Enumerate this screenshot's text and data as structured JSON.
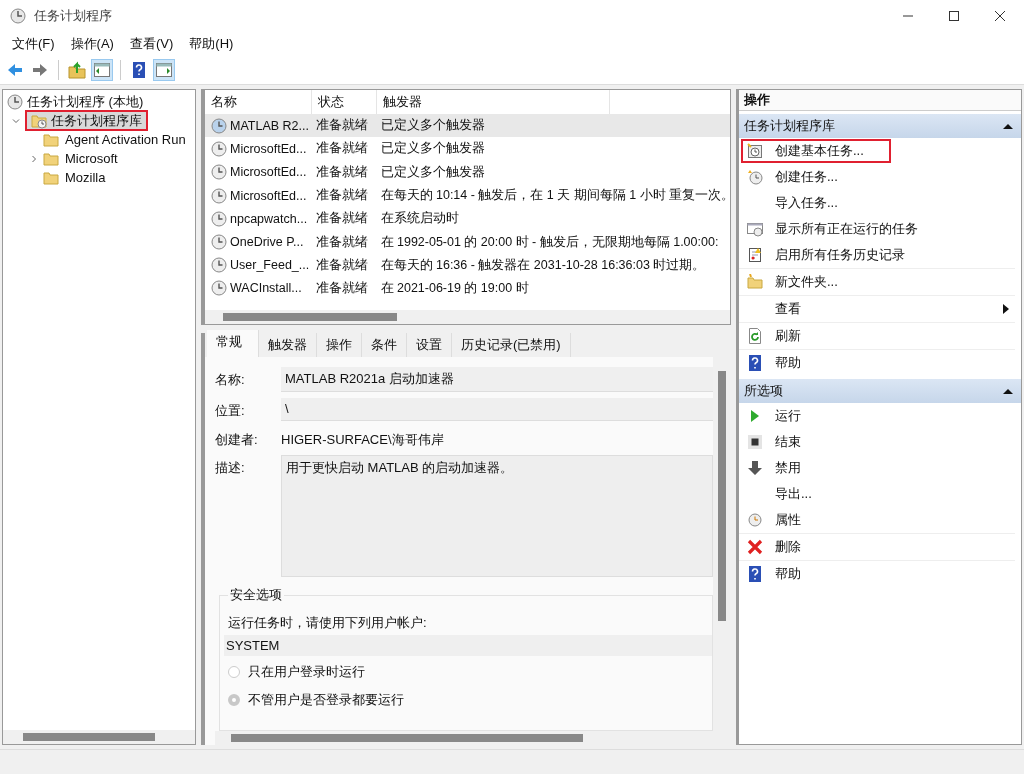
{
  "window": {
    "title": "任务计划程序"
  },
  "menu": [
    {
      "label": "文件(F)"
    },
    {
      "label": "操作(A)"
    },
    {
      "label": "查看(V)"
    },
    {
      "label": "帮助(H)"
    }
  ],
  "toolbar": [
    {
      "kind": "back",
      "on": false
    },
    {
      "kind": "forward",
      "on": false
    },
    {
      "kind": "up-folder",
      "on": false
    },
    {
      "kind": "tree-pane",
      "on": true
    },
    {
      "kind": "help",
      "on": false
    },
    {
      "kind": "action-pane",
      "on": true
    }
  ],
  "tree": {
    "label": "任务计划程序 (本地)",
    "children": [
      {
        "label": "任务计划程序库",
        "expanded": true,
        "selected": true,
        "highlighted": true,
        "children": [
          {
            "label": "Agent Activation Run",
            "selected": false,
            "highlighted": false
          },
          {
            "label": "Microsoft",
            "expanded": false,
            "selected": false,
            "highlighted": false
          },
          {
            "label": "Mozilla",
            "selected": false,
            "highlighted": false
          }
        ]
      }
    ]
  },
  "task_table": {
    "columns": [
      "名称",
      "状态",
      "触发器"
    ],
    "rows": [
      {
        "name": "MATLAB R2...",
        "status": "准备就绪",
        "trigger": "已定义多个触发器",
        "selected": true
      },
      {
        "name": "MicrosoftEd...",
        "status": "准备就绪",
        "trigger": "已定义多个触发器",
        "selected": false
      },
      {
        "name": "MicrosoftEd...",
        "status": "准备就绪",
        "trigger": "已定义多个触发器",
        "selected": false
      },
      {
        "name": "MicrosoftEd...",
        "status": "准备就绪",
        "trigger": "在每天的 10:14 - 触发后，在 1 天 期间每隔 1 小时 重复一次。",
        "selected": false
      },
      {
        "name": "npcapwatch...",
        "status": "准备就绪",
        "trigger": "在系统启动时",
        "selected": false
      },
      {
        "name": "OneDrive P...",
        "status": "准备就绪",
        "trigger": "在 1992-05-01 的 20:00 时 - 触发后，无限期地每隔 1.00:00:",
        "selected": false
      },
      {
        "name": "User_Feed_...",
        "status": "准备就绪",
        "trigger": "在每天的 16:36 - 触发器在 2031-10-28 16:36:03 时过期。",
        "selected": false
      },
      {
        "name": "WACInstall...",
        "status": "准备就绪",
        "trigger": "在 2021-06-19 的 19:00 时",
        "selected": false
      }
    ]
  },
  "detail_tabs": [
    {
      "label": "常规",
      "selected": true
    },
    {
      "label": "触发器",
      "selected": false
    },
    {
      "label": "操作",
      "selected": false
    },
    {
      "label": "条件",
      "selected": false
    },
    {
      "label": "设置",
      "selected": false
    },
    {
      "label": "历史记录(已禁用)",
      "selected": false
    }
  ],
  "general": {
    "fields": [
      {
        "label": "名称:",
        "value": "MATLAB R2021a 启动加速器",
        "kind": "input"
      },
      {
        "label": "位置:",
        "value": "\\",
        "kind": "input"
      },
      {
        "label": "创建者:",
        "value": "HIGER-SURFACE\\海哥伟岸",
        "kind": "text"
      },
      {
        "label": "描述:",
        "value": "用于更快启动 MATLAB 的启动加速器。",
        "kind": "textarea"
      }
    ],
    "security": {
      "title": "安全选项",
      "prompt": "运行任务时，请使用下列用户帐户:",
      "account": "SYSTEM",
      "options": [
        {
          "label": "只在用户登录时运行",
          "selected": false
        },
        {
          "label": "不管用户是否登录都要运行",
          "selected": true
        }
      ]
    }
  },
  "actions": {
    "title": "操作",
    "sections": [
      {
        "title": "任务计划程序库",
        "expanded": true,
        "items": [
          {
            "label": "创建基本任务...",
            "kind": "create-basic",
            "highlighted": true,
            "submenu": false,
            "divider": false
          },
          {
            "label": "创建任务...",
            "kind": "create",
            "highlighted": false,
            "submenu": false,
            "divider": false
          },
          {
            "label": "导入任务...",
            "kind": "plain",
            "highlighted": false,
            "submenu": false,
            "divider": false
          },
          {
            "label": "显示所有正在运行的任务",
            "kind": "running",
            "highlighted": false,
            "submenu": false,
            "divider": false
          },
          {
            "label": "启用所有任务历史记录",
            "kind": "history",
            "highlighted": false,
            "submenu": false,
            "divider": true
          },
          {
            "label": "新文件夹...",
            "kind": "folder",
            "highlighted": false,
            "submenu": false,
            "divider": true
          },
          {
            "label": "查看",
            "kind": "plain",
            "highlighted": false,
            "submenu": true,
            "divider": true
          },
          {
            "label": "刷新",
            "kind": "refresh",
            "highlighted": false,
            "submenu": false,
            "divider": true
          },
          {
            "label": "帮助",
            "kind": "help",
            "highlighted": false,
            "submenu": false,
            "divider": false
          }
        ]
      },
      {
        "title": "所选项",
        "expanded": true,
        "items": [
          {
            "label": "运行",
            "kind": "run",
            "highlighted": false,
            "submenu": false,
            "divider": false
          },
          {
            "label": "结束",
            "kind": "stop",
            "highlighted": false,
            "submenu": false,
            "divider": false
          },
          {
            "label": "禁用",
            "kind": "disable",
            "highlighted": false,
            "submenu": false,
            "divider": false
          },
          {
            "label": "导出...",
            "kind": "plain",
            "highlighted": false,
            "submenu": false,
            "divider": false
          },
          {
            "label": "属性",
            "kind": "properties",
            "highlighted": false,
            "submenu": false,
            "divider": true
          },
          {
            "label": "删除",
            "kind": "delete",
            "highlighted": false,
            "submenu": false,
            "divider": true
          },
          {
            "label": "帮助",
            "kind": "help",
            "highlighted": false,
            "submenu": false,
            "divider": false
          }
        ]
      }
    ]
  }
}
